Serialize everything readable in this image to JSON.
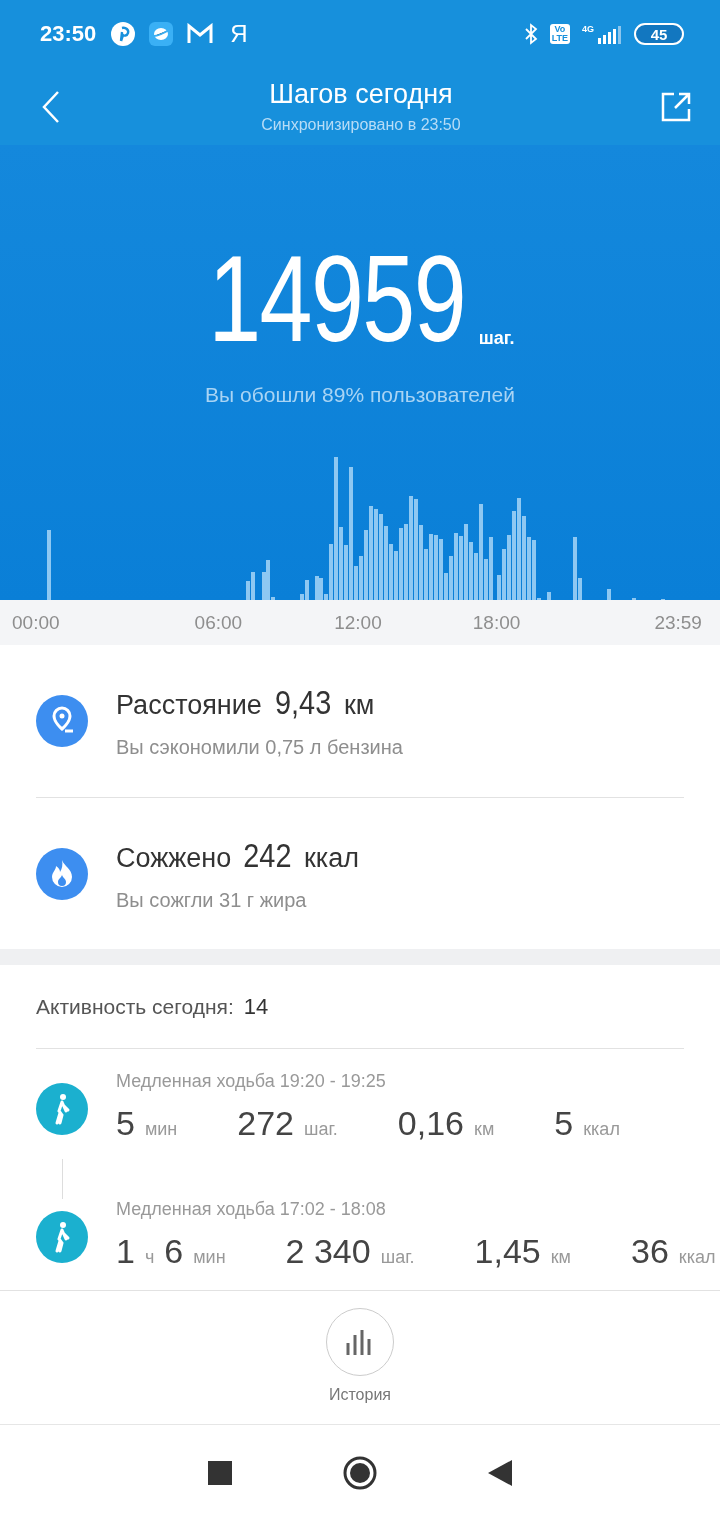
{
  "status_bar": {
    "time": "23:50",
    "notification_letter": "Я",
    "volte": [
      "Vo",
      "LTE"
    ],
    "network": "4G",
    "battery": "45"
  },
  "header": {
    "title": "Шагов сегодня",
    "subtitle": "Синхронизировано в 23:50"
  },
  "steps": {
    "count": "14959",
    "unit": "шаг.",
    "comparison": "Вы обошли 89% пользователей"
  },
  "time_axis": [
    "00:00",
    "06:00",
    "12:00",
    "18:00",
    "23:59"
  ],
  "stats": [
    {
      "kind": "distance",
      "label": "Расстояние",
      "value": "9,43",
      "unit": "км",
      "note": "Вы сэкономили 0,75 л бензина"
    },
    {
      "kind": "calories",
      "label": "Сожжено",
      "value": "242",
      "unit": "ккал",
      "note": "Вы сожгли 31 г жира"
    }
  ],
  "activity": {
    "label": "Активность сегодня:",
    "count": "14",
    "items": [
      {
        "title": "Медленная ходьба 19:20 - 19:25",
        "metrics": [
          [
            {
              "value": "5",
              "unit": "мин"
            }
          ],
          [
            {
              "value": "272",
              "unit": "шаг."
            }
          ],
          [
            {
              "value": "0,16",
              "unit": "км"
            }
          ],
          [
            {
              "value": "5",
              "unit": "ккал"
            }
          ]
        ]
      },
      {
        "title": "Медленная ходьба 17:02 - 18:08",
        "metrics": [
          [
            {
              "value": "1",
              "unit": "ч"
            },
            {
              "value": "6",
              "unit": "мин"
            }
          ],
          [
            {
              "value": "2 340",
              "unit": "шаг."
            }
          ],
          [
            {
              "value": "1,45",
              "unit": "км"
            }
          ],
          [
            {
              "value": "36",
              "unit": "ккал"
            }
          ]
        ]
      }
    ]
  },
  "history_button": {
    "label": "История"
  }
}
